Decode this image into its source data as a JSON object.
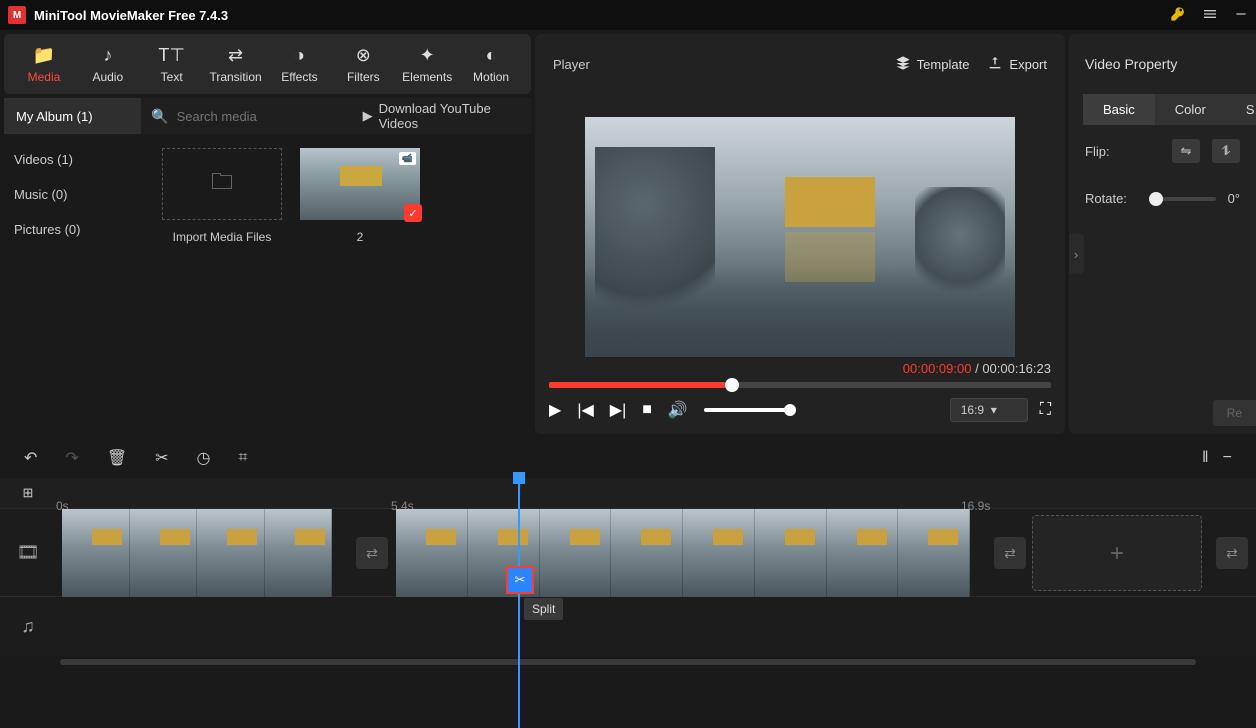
{
  "app": {
    "title": "MiniTool MovieMaker Free 7.4.3"
  },
  "tabs": [
    {
      "label": "Media",
      "active": true
    },
    {
      "label": "Audio"
    },
    {
      "label": "Text"
    },
    {
      "label": "Transition"
    },
    {
      "label": "Effects"
    },
    {
      "label": "Filters"
    },
    {
      "label": "Elements"
    },
    {
      "label": "Motion"
    }
  ],
  "album": {
    "active": "My Album (1)",
    "search_placeholder": "Search media",
    "yt_link": "Download YouTube Videos",
    "items": [
      {
        "label": "Videos (1)"
      },
      {
        "label": "Music (0)"
      },
      {
        "label": "Pictures (0)"
      }
    ],
    "import_label": "Import Media Files",
    "thumb_label": "2"
  },
  "player": {
    "title": "Player",
    "template": "Template",
    "export": "Export",
    "time_current": "00:00:09:00",
    "time_sep": " / ",
    "time_total": "00:00:16:23",
    "aspect": "16:9"
  },
  "props": {
    "title": "Video Property",
    "tab_basic": "Basic",
    "tab_color": "Color",
    "flip_label": "Flip:",
    "rotate_label": "Rotate:",
    "rotate_value": "0°",
    "disabled_btn": "Re"
  },
  "timeline": {
    "ticks": [
      {
        "label": "0s",
        "pos": 0
      },
      {
        "label": "5.4s",
        "pos": 335
      },
      {
        "label": "16.9s",
        "pos": 905
      }
    ],
    "split_tooltip": "Split"
  }
}
